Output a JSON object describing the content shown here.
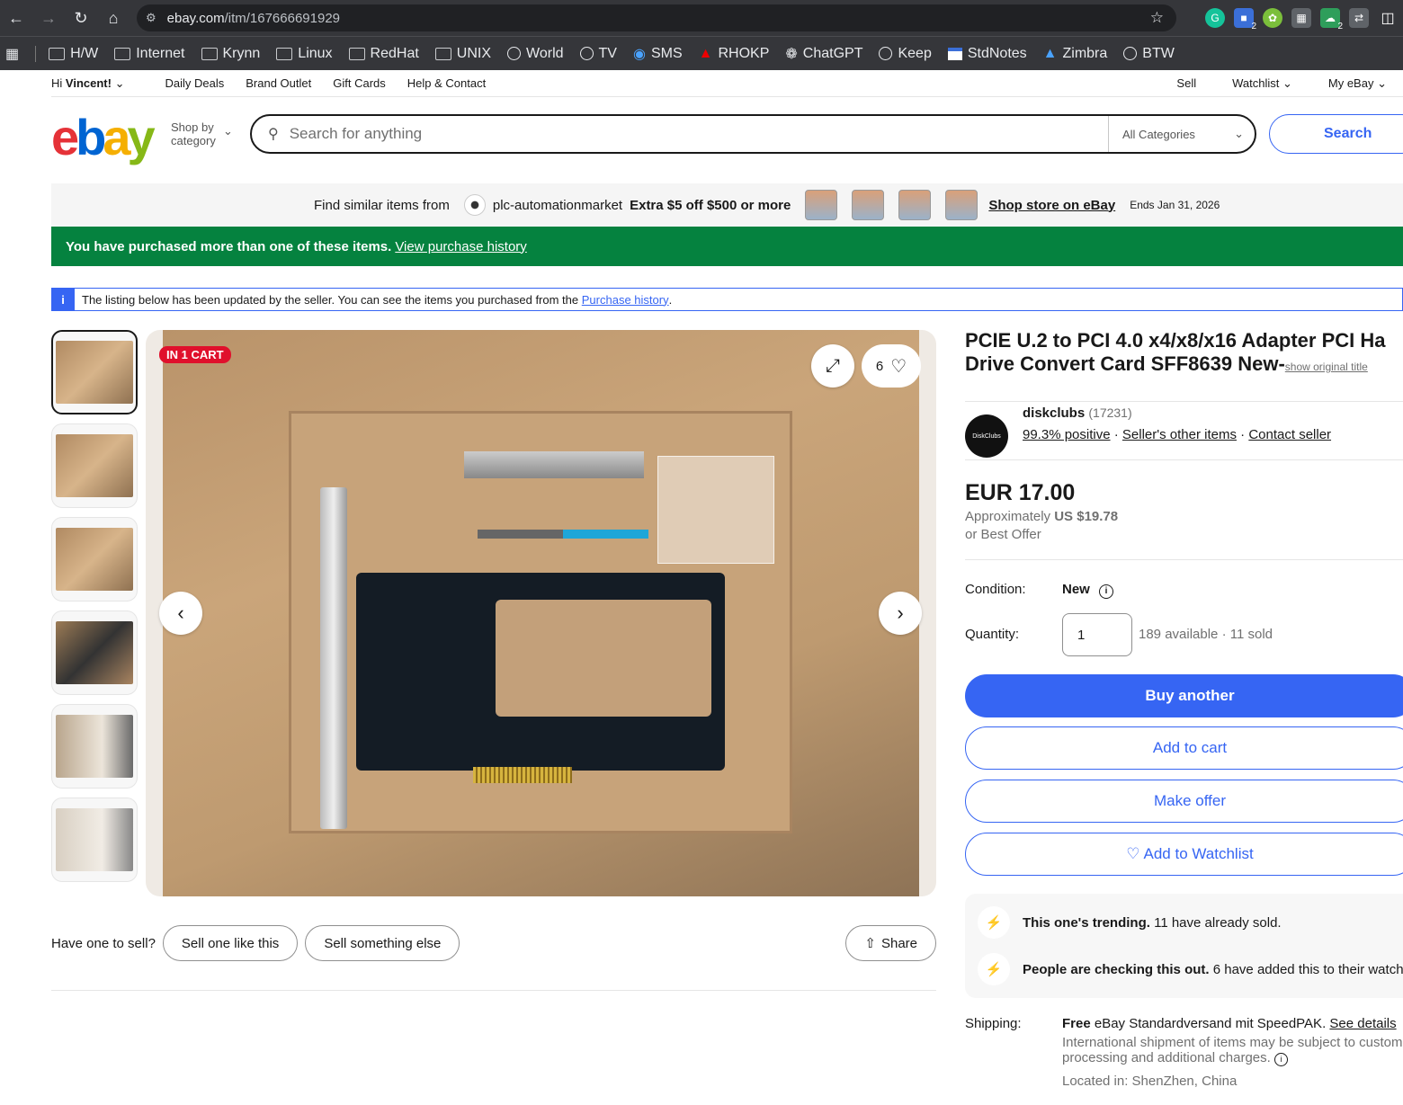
{
  "browser": {
    "url_host": "ebay.com",
    "url_path": "/itm/167666691929",
    "bookmarks": [
      "H/W",
      "Internet",
      "Krynn",
      "Linux",
      "RedHat",
      "UNIX",
      "World",
      "TV",
      "SMS",
      "RHOKP",
      "ChatGPT",
      "Keep",
      "StdNotes",
      "Zimbra",
      "BTW"
    ],
    "ext_badges": [
      "2",
      "2"
    ]
  },
  "topnav": {
    "greeting": "Hi",
    "user": "Vincent!",
    "links": [
      "Daily Deals",
      "Brand Outlet",
      "Gift Cards",
      "Help & Contact"
    ],
    "right": [
      "Sell",
      "Watchlist",
      "My eBay"
    ]
  },
  "header": {
    "shop_by": "Shop by",
    "category": "category",
    "search_placeholder": "Search for anything",
    "all_categories": "All Categories",
    "search_button": "Search"
  },
  "promo": {
    "lead": "Find similar items from",
    "store": "plc-automationmarket",
    "offer": "Extra $5 off $500 or more",
    "shop_link": "Shop store on eBay",
    "ends": "Ends Jan 31, 2026"
  },
  "purchased": {
    "text": "You have purchased more than one of these items.",
    "link": "View purchase history"
  },
  "notice": {
    "text": "The listing below has been updated by the seller. You can see the items you purchased from the",
    "link": "Purchase history",
    "end": "."
  },
  "gallery": {
    "badge": "IN 1 CART",
    "watch_count": "6"
  },
  "sell": {
    "prompt": "Have one to sell?",
    "like_this": "Sell one like this",
    "else": "Sell something else",
    "share": "Share"
  },
  "item": {
    "title_line1": "PCIE U.2 to PCI 4.0 x4/x8/x16 Adapter PCI Ha",
    "title_line2": "Drive Convert Card SFF8639 New-",
    "show_original": "show original title",
    "seller_name": "diskclubs",
    "seller_score": "(17231)",
    "seller_avatar": "DiskClubs",
    "positive": "99.3% positive",
    "other_items": "Seller's other items",
    "contact": "Contact seller",
    "price": "EUR 17.00",
    "approx_label": "Approximately",
    "approx_value": "US $19.78",
    "best_offer": "or Best Offer",
    "condition_label": "Condition:",
    "condition_value": "New",
    "quantity_label": "Quantity:",
    "quantity_value": "1",
    "availability": "189 available · 11 sold",
    "buy_another": "Buy another",
    "add_to_cart": "Add to cart",
    "make_offer": "Make offer",
    "add_watchlist": "Add to Watchlist",
    "trend1_bold": "This one's trending.",
    "trend1_rest": "11 have already sold.",
    "trend2_bold": "People are checking this out.",
    "trend2_rest": "6 have added this to their watchlis",
    "shipping_label": "Shipping:",
    "shipping_free": "Free",
    "shipping_service": "eBay Standardversand mit SpeedPAK.",
    "see_details": "See details",
    "shipping_note1": "International shipment of items may be subject to custom",
    "shipping_note2": "processing and additional charges.",
    "located": "Located in: ShenZhen, China"
  },
  "colors": {
    "ebay_blue": "#3665f3",
    "green_banner": "#05823f",
    "cart_red": "#e0102c"
  }
}
